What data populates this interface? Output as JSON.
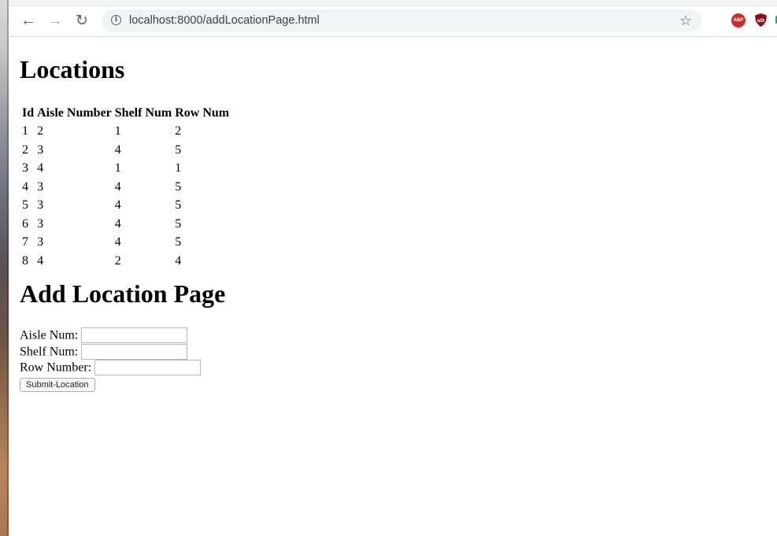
{
  "browser": {
    "url": "localhost:8000/addLocationPage.html",
    "extensions": [
      "adblock-plus-icon",
      "ublock-icon",
      "mail-icon"
    ],
    "abp_label": "ABP",
    "ub_label": "uD"
  },
  "locations": {
    "title": "Locations",
    "columns": [
      "Id",
      "Aisle Number",
      "Shelf Num",
      "Row Num"
    ],
    "rows": [
      [
        "1",
        "2",
        "1",
        "2"
      ],
      [
        "2",
        "3",
        "4",
        "5"
      ],
      [
        "3",
        "4",
        "1",
        "1"
      ],
      [
        "4",
        "3",
        "4",
        "5"
      ],
      [
        "5",
        "3",
        "4",
        "5"
      ],
      [
        "6",
        "3",
        "4",
        "5"
      ],
      [
        "7",
        "3",
        "4",
        "5"
      ],
      [
        "8",
        "4",
        "2",
        "4"
      ]
    ]
  },
  "form": {
    "title": "Add Location Page",
    "aisle_label": "Aisle Num:",
    "shelf_label": "Shelf Num:",
    "row_label": "Row Number:",
    "aisle_value": "",
    "shelf_value": "",
    "row_value": "",
    "submit_label": "Submit-Location"
  }
}
